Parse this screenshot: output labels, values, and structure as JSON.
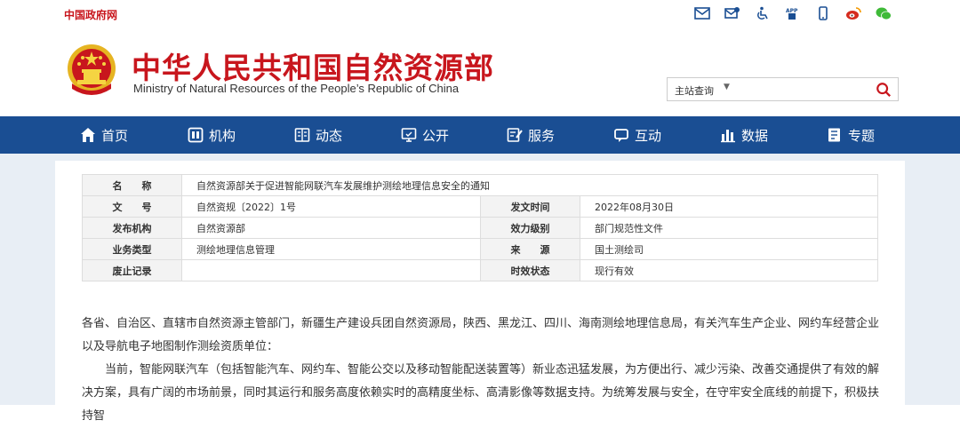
{
  "topbar": {
    "gov_link": "中国政府网",
    "icons": [
      "mail-icon",
      "mailbox-icon",
      "accessibility-icon",
      "app-icon",
      "mobile-icon",
      "weibo-icon",
      "wechat-icon"
    ]
  },
  "header": {
    "title_cn": "中华人民共和国自然资源部",
    "title_en": "Ministry of Natural Resources of the People’s Republic of China",
    "search_scope": "主站查询",
    "search_placeholder": ""
  },
  "nav": {
    "items": [
      {
        "label": "首页",
        "icon": "home-icon"
      },
      {
        "label": "机构",
        "icon": "org-icon"
      },
      {
        "label": "动态",
        "icon": "news-icon"
      },
      {
        "label": "公开",
        "icon": "public-icon"
      },
      {
        "label": "服务",
        "icon": "service-icon"
      },
      {
        "label": "互动",
        "icon": "chat-icon"
      },
      {
        "label": "数据",
        "icon": "chart-icon"
      },
      {
        "label": "专题",
        "icon": "topic-icon"
      }
    ]
  },
  "meta": {
    "name_key": "名　　称",
    "name_val": "自然资源部关于促进智能网联汽车发展维护测绘地理信息安全的通知",
    "docno_key": "文　　号",
    "docno_val": "自然资规〔2022〕1号",
    "date_key": "发文时间",
    "date_val": "2022年08月30日",
    "org_key": "发布机构",
    "org_val": "自然资源部",
    "level_key": "效力级别",
    "level_val": "部门规范性文件",
    "type_key": "业务类型",
    "type_val": "测绘地理信息管理",
    "source_key": "来　　源",
    "source_val": "国土测绘司",
    "abolish_key": "废止记录",
    "abolish_val": "",
    "status_key": "时效状态",
    "status_val": "现行有效"
  },
  "body": {
    "p1": "各省、自治区、直辖市自然资源主管部门，新疆生产建设兵团自然资源局，陕西、黑龙江、四川、海南测绘地理信息局，有关汽车生产企业、网约车经营企业以及导航电子地图制作测绘资质单位：",
    "p2": "当前，智能网联汽车（包括智能汽车、网约车、智能公交以及移动智能配送装置等）新业态迅猛发展，为方便出行、减少污染、改善交通提供了有效的解决方案，具有广阔的市场前景，同时其运行和服务高度依赖实时的高精度坐标、高清影像等数据支持。为统筹发展与安全，在守牢安全底线的前提下，积极扶持智"
  },
  "colors": {
    "brand_red": "#c8161d",
    "nav_blue": "#1a4e93",
    "content_bg": "#e8eef5"
  }
}
